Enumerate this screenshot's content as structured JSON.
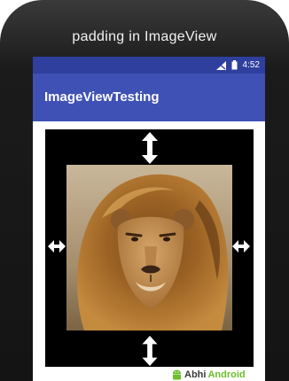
{
  "device": {
    "caption": "padding in ImageView"
  },
  "status_bar": {
    "time": "4:52",
    "icons": [
      "signal-icon",
      "battery-icon"
    ]
  },
  "app_bar": {
    "title": "ImageViewTesting"
  },
  "content": {
    "image": {
      "subject": "lion-image",
      "background": "#000000"
    },
    "padding_arrows": [
      "arrow-up-down-icon",
      "arrow-left-right-icon"
    ]
  },
  "watermark": {
    "part1": "Abhi",
    "part2": "Android"
  },
  "colors": {
    "app_bar": "#3f51b5",
    "status_bar": "#2f3f9e",
    "brand_green": "#6abf2a"
  }
}
